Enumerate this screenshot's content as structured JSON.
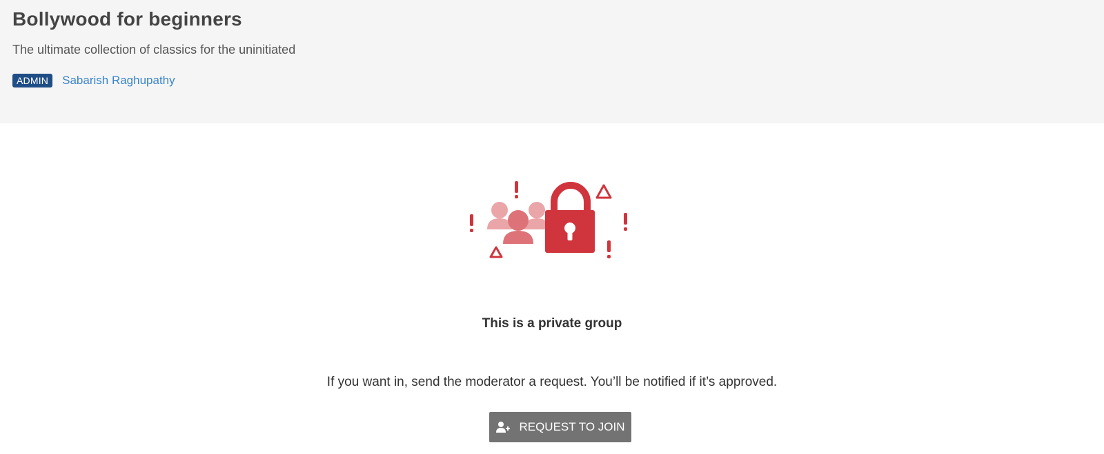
{
  "group": {
    "title": "Bollywood for beginners",
    "description": "The ultimate collection of classics for the uninitiated",
    "admin_badge": "ADMIN",
    "admin_name": "Sabarish Raghupathy"
  },
  "private_notice": {
    "illustration_icon": "private-group-lock-illustration",
    "heading": "This is a private group",
    "message": "If you want in, send the moderator a request. You’ll be notified if it’s approved.",
    "button_label": "REQUEST TO JOIN",
    "button_icon": "add-user-icon"
  },
  "colors": {
    "header_bg": "#f5f5f5",
    "admin_badge_bg": "#1f4d86",
    "link": "#3a84c9",
    "accent_red": "#d0343c",
    "accent_red_light": "#eaa5a8",
    "button_bg": "#737373"
  }
}
